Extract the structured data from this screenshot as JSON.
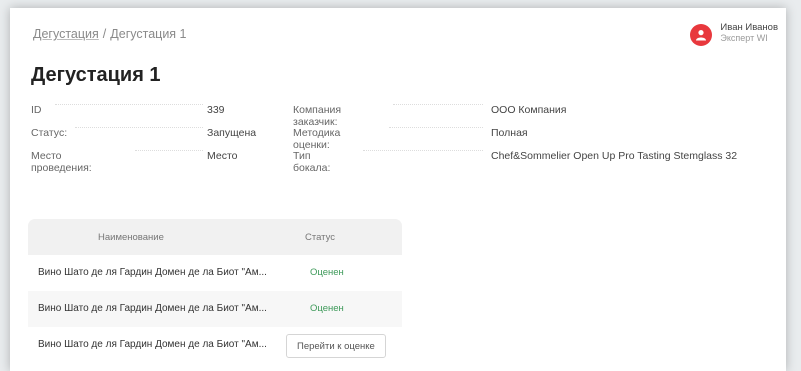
{
  "breadcrumb": {
    "root": "Дегустация",
    "separator": "/",
    "current": "Дегустация 1"
  },
  "user": {
    "name": "Иван Иванов",
    "role": "Эксперт WI"
  },
  "page_title": "Дегустация 1",
  "fields": {
    "left": [
      {
        "label": "ID",
        "value": "339"
      },
      {
        "label": "Статус:",
        "value": "Запущена"
      },
      {
        "label": "Место проведения:",
        "value": "Место"
      }
    ],
    "right": [
      {
        "label": "Компания заказчик:",
        "value": "ООО Компания"
      },
      {
        "label": "Методика оценки:",
        "value": "Полная"
      },
      {
        "label": "Тип бокала:",
        "value": "Chef&Sommelier Open Up Pro Tasting Stemglass 32"
      }
    ]
  },
  "table": {
    "headers": {
      "name": "Наименование",
      "status": "Статус"
    },
    "rows": [
      {
        "name": "Вино Шато де ля Гардин Домен де ла Биот \"Ам...",
        "status": "Оценен"
      },
      {
        "name": "Вино Шато де ля Гардин Домен де ла Биот \"Ам...",
        "status": "Оценен"
      },
      {
        "name": "Вино Шато де ля Гардин Домен де ла Биот \"Ам...",
        "action": "Перейти к оценке"
      }
    ],
    "status_color": "#3e9a5a"
  },
  "colors": {
    "avatar": "#e8383d",
    "background": "#e9ecee"
  }
}
